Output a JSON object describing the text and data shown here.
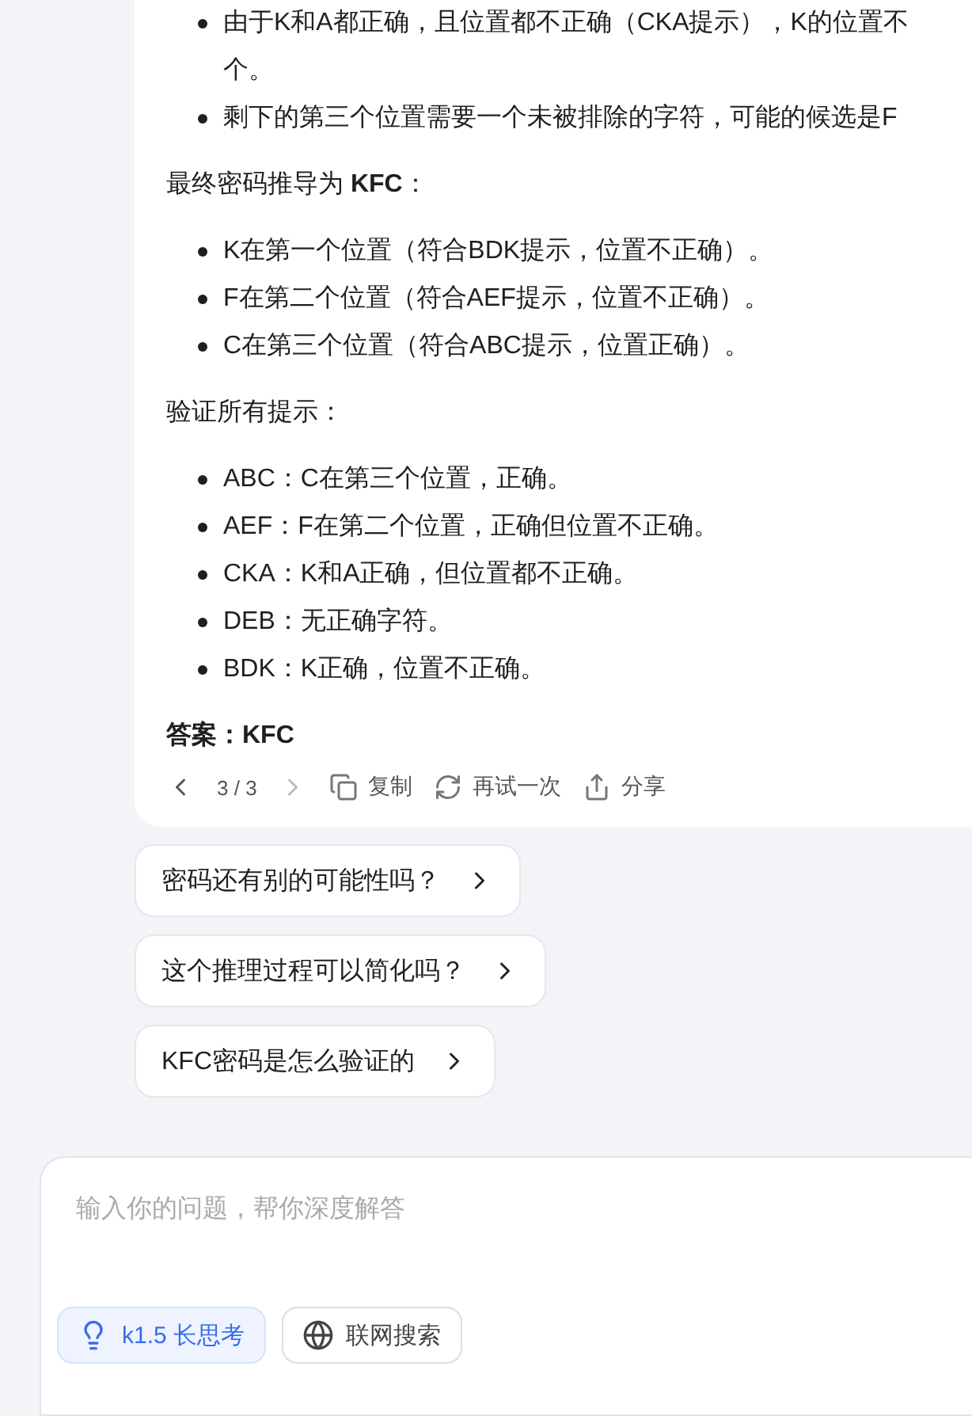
{
  "answer": {
    "blocks": [
      {
        "kind": "list",
        "items": [
          {
            "lines": [
              "由于K和A都正确，且位置都不正确（CKA提示），K的位置不",
              "个。"
            ]
          },
          {
            "lines": [
              "剩下的第三个位置需要一个未被排除的字符，可能的候选是F"
            ]
          }
        ]
      },
      {
        "kind": "para",
        "text": "最终密码推导为 **KFC**："
      },
      {
        "kind": "list",
        "items": [
          {
            "lines": [
              "K在第一个位置（符合BDK提示，位置不正确）。"
            ]
          },
          {
            "lines": [
              "F在第二个位置（符合AEF提示，位置不正确）。"
            ]
          },
          {
            "lines": [
              "C在第三个位置（符合ABC提示，位置正确）。"
            ]
          }
        ]
      },
      {
        "kind": "para",
        "text": "验证所有提示："
      },
      {
        "kind": "list",
        "items": [
          {
            "lines": [
              "ABC：C在第三个位置，正确。"
            ]
          },
          {
            "lines": [
              "AEF：F在第二个位置，正确但位置不正确。"
            ]
          },
          {
            "lines": [
              "CKA：K和A正确，但位置都不正确。"
            ]
          },
          {
            "lines": [
              "DEB：无正确字符。"
            ]
          },
          {
            "lines": [
              "BDK：K正确，位置不正确。"
            ]
          }
        ]
      },
      {
        "kind": "bold",
        "text": "答案：KFC"
      }
    ],
    "pager": "3 / 3",
    "actions": [
      {
        "kind": "copy",
        "label": "复制"
      },
      {
        "kind": "retry",
        "label": "再试一次"
      },
      {
        "kind": "share",
        "label": "分享"
      }
    ]
  },
  "suggestions": [
    "密码还有别的可能性吗？",
    "这个推理过程可以简化吗？",
    "KFC密码是怎么验证的"
  ],
  "input": {
    "placeholder": "输入你的问题，帮你深度解答",
    "toggles": [
      {
        "kind": "think",
        "label": "k1.5 长思考",
        "selected": true
      },
      {
        "kind": "web",
        "label": "联网搜索",
        "selected": false
      }
    ]
  }
}
